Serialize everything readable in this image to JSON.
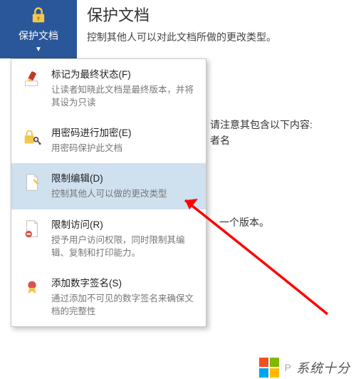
{
  "ribbon": {
    "button_label": "保护文档",
    "title": "保护文档",
    "desc": "控制其他人可以对此文档所做的更改类型。"
  },
  "menu": [
    {
      "title": "标记为最终状态(F)",
      "desc": "让读者知晓此文档是最终版本，并将其设为只读"
    },
    {
      "title": "用密码进行加密(E)",
      "desc": "用密码保护此文档"
    },
    {
      "title": "限制编辑(D)",
      "desc": "控制其他人可以做的更改类型"
    },
    {
      "title": "限制访问(R)",
      "desc": "授予用户访问权限，同时限制其编辑、复制和打印能力。"
    },
    {
      "title": "添加数字签名(S)",
      "desc": "通过添加不可见的数字签名来确保文档的完整性"
    }
  ],
  "bg": {
    "line1_a": "请注意其包含以下内容:",
    "line1_b": "者名",
    "line2": "一个版本。"
  },
  "footer": {
    "text": "系统十分",
    "dot": "P"
  }
}
